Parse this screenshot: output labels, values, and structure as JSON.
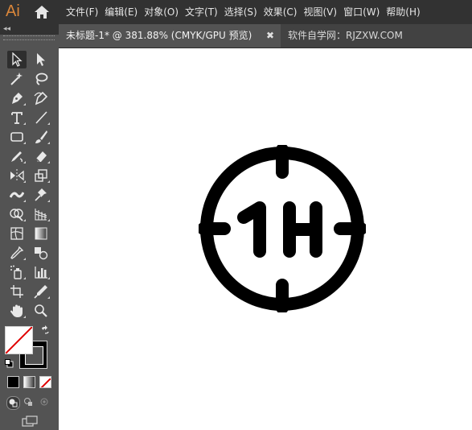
{
  "app": {
    "logo": "Ai"
  },
  "menu": [
    {
      "label": "文件(F)"
    },
    {
      "label": "编辑(E)"
    },
    {
      "label": "对象(O)"
    },
    {
      "label": "文字(T)"
    },
    {
      "label": "选择(S)"
    },
    {
      "label": "效果(C)"
    },
    {
      "label": "视图(V)"
    },
    {
      "label": "窗口(W)"
    },
    {
      "label": "帮助(H)"
    }
  ],
  "panel": {
    "collapse_glyph": "◂◂"
  },
  "tabs": {
    "active": {
      "title": "未标题-1* @ 381.88% (CMYK/GPU 预览)",
      "close_glyph": "✖"
    },
    "other": {
      "title": "软件自学网：RJZXW.COM"
    }
  },
  "tools": [
    {
      "icon": "selection-tool-icon"
    },
    {
      "icon": "direct-selection-tool-icon"
    },
    {
      "icon": "magic-wand-tool-icon"
    },
    {
      "icon": "lasso-tool-icon"
    },
    {
      "icon": "pen-tool-icon"
    },
    {
      "icon": "curvature-tool-icon"
    },
    {
      "icon": "type-tool-icon",
      "glyph": "T"
    },
    {
      "icon": "line-segment-tool-icon"
    },
    {
      "icon": "rectangle-tool-icon"
    },
    {
      "icon": "paintbrush-tool-icon"
    },
    {
      "icon": "shaper-tool-icon"
    },
    {
      "icon": "eraser-tool-icon"
    },
    {
      "icon": "reflect-tool-icon"
    },
    {
      "icon": "scale-tool-icon"
    },
    {
      "icon": "width-tool-icon"
    },
    {
      "icon": "puppet-warp-tool-icon"
    },
    {
      "icon": "shape-builder-tool-icon"
    },
    {
      "icon": "perspective-grid-tool-icon"
    },
    {
      "icon": "mesh-tool-icon"
    },
    {
      "icon": "gradient-tool-icon"
    },
    {
      "icon": "eyedropper-tool-icon"
    },
    {
      "icon": "blend-tool-icon"
    },
    {
      "icon": "symbol-sprayer-tool-icon"
    },
    {
      "icon": "column-graph-tool-icon"
    },
    {
      "icon": "artboard-tool-icon"
    },
    {
      "icon": "slice-tool-icon"
    },
    {
      "icon": "hand-tool-icon"
    },
    {
      "icon": "zoom-tool-icon"
    }
  ],
  "swatches": {
    "fill": "none",
    "stroke": "#000000"
  },
  "artwork": {
    "text": "1H",
    "color": "#000000"
  }
}
